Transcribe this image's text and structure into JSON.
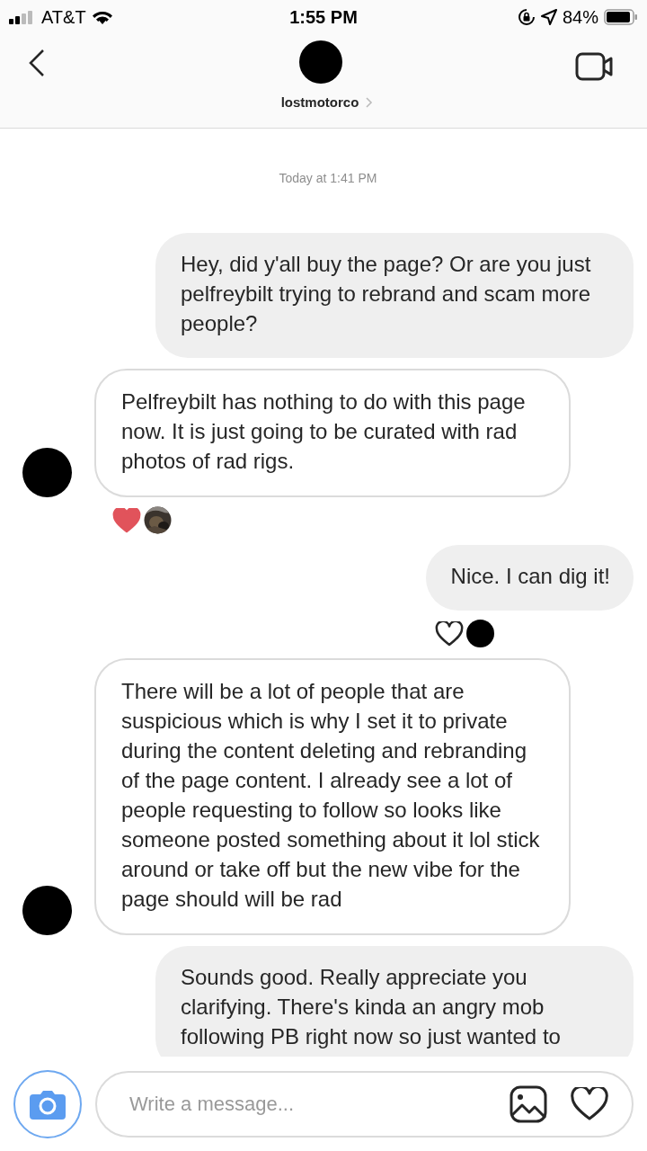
{
  "status_bar": {
    "carrier": "AT&T",
    "time": "1:55 PM",
    "battery": "84%"
  },
  "header": {
    "username": "lostmotorco"
  },
  "timestamp": "Today at 1:41 PM",
  "messages": [
    {
      "kind": "outgoing",
      "text": "Hey, did y'all buy the page? Or are you just pelfreybilt trying to rebrand and scam more people?"
    },
    {
      "kind": "incoming",
      "text": "Pelfreybilt has nothing to do with this page now. It is just going to be curated with rad photos of rad rigs.",
      "reaction": {
        "liked": true,
        "reactor_has_photo": true
      }
    },
    {
      "kind": "outgoing",
      "text": "Nice. I can dig it!",
      "reaction": {
        "liked": false,
        "reactor_has_photo": false
      }
    },
    {
      "kind": "incoming",
      "text": "There will be a lot of people that are suspicious which is why I set it to private during the content deleting and rebranding of the page content. I already see a lot of people requesting to follow so looks like someone posted something about it lol stick around or take off but the new vibe for the page should will be rad"
    },
    {
      "kind": "outgoing",
      "text": "Sounds good. Really appreciate you clarifying. There's kinda an angry mob following PB right now so just wanted to"
    }
  ],
  "composer": {
    "placeholder": "Write a message..."
  }
}
